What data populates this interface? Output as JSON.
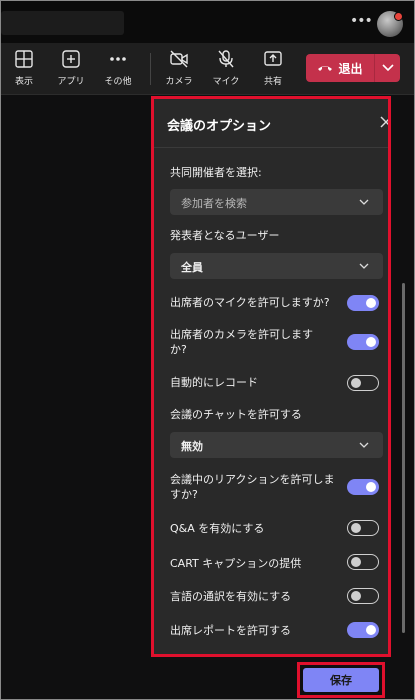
{
  "toolbar": {
    "view_label": "表示",
    "apps_label": "アプリ",
    "more_label": "その他",
    "camera_label": "カメラ",
    "mic_label": "マイク",
    "share_label": "共有",
    "leave_label": "退出"
  },
  "panel": {
    "title": "会議のオプション",
    "cohost_label": "共同開催者を選択:",
    "cohost_placeholder": "参加者を検索",
    "presenters_label": "発表者となるユーザー",
    "presenters_value": "全員",
    "allow_mic_label": "出席者のマイクを許可しますか?",
    "allow_camera_label": "出席者のカメラを許可しますか?",
    "auto_record_label": "自動的にレコード",
    "chat_label": "会議のチャットを許可する",
    "chat_value": "無効",
    "reactions_label": "会議中のリアクションを許可しますか?",
    "qa_label": "Q&A を有効にする",
    "cart_label": "CART キャプションの提供",
    "interpretation_label": "言語の通訳を有効にする",
    "attendance_label": "出席レポートを許可する"
  },
  "toggles": {
    "allow_mic": true,
    "allow_camera": true,
    "auto_record": false,
    "reactions": true,
    "qa": false,
    "cart": false,
    "interpretation": false,
    "attendance": true
  },
  "footer": {
    "save_label": "保存"
  },
  "colors": {
    "accent": "#7f85f5",
    "leave": "#c4314b",
    "highlight": "#e0102d"
  }
}
